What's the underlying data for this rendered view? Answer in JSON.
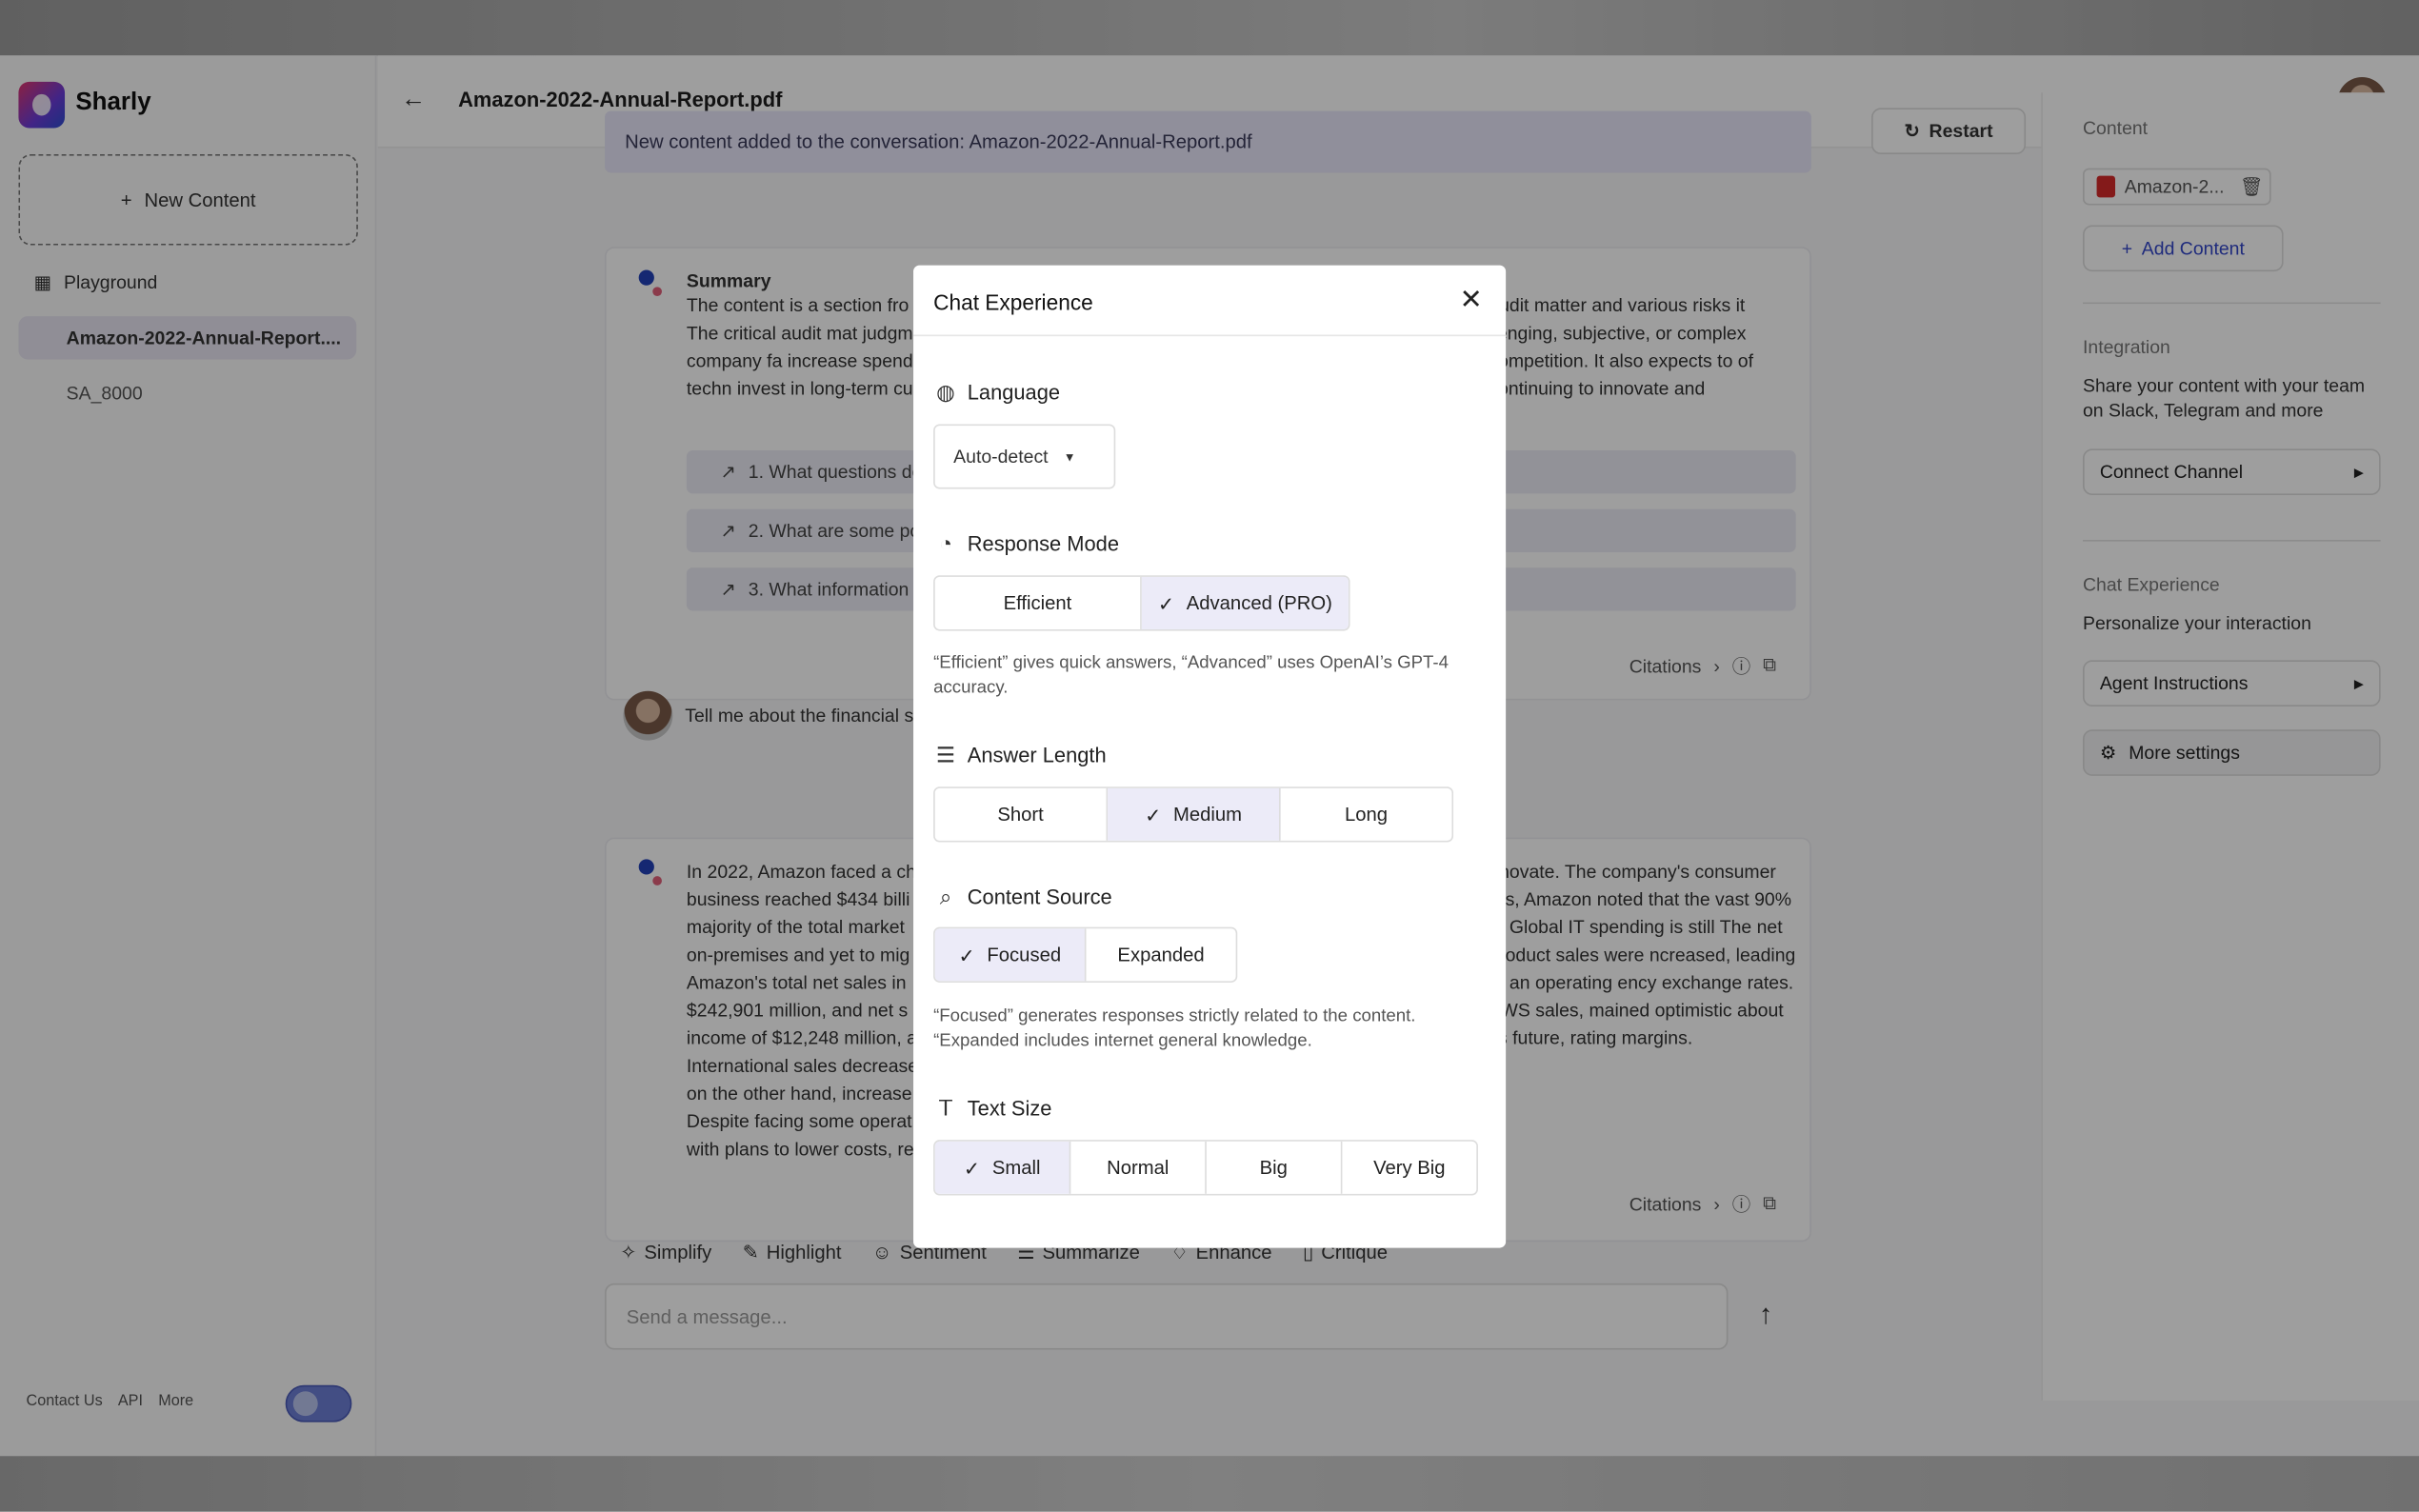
{
  "app": {
    "brand": "Sharly"
  },
  "sidebar": {
    "new_content": "New Content",
    "items": [
      {
        "label": "Playground"
      },
      {
        "label": "Amazon-2022-Annual-Report...."
      },
      {
        "label": "SA_8000"
      }
    ],
    "footer": [
      "Contact Us",
      "API",
      "More"
    ]
  },
  "header": {
    "title": "Amazon-2022-Annual-Report.pdf"
  },
  "chat": {
    "banner": "New content added to the conversation: Amazon-2022-Annual-Report.pdf",
    "restart": "Restart",
    "summary_title": "Summary",
    "summary_left": "The content is a section fro faces. The critical audit mat judgments. The company fa increase spending on techn invest in long-term custome",
    "summary_right": "audit matter and various risks it llenging, subjective, or complex competition. It also expects to of continuing to innovate and",
    "questions": [
      "1. What questions do",
      "2. What are some po",
      "3. What information"
    ],
    "citations": "Citations",
    "user_message": "Tell me about the financial s",
    "answer_left": "In 2022, Amazon faced a ch business reached $434 billi majority of the total market on-premises and yet to mig Amazon's total net sales in $242,901 million, and net s income of $12,248 million, a International sales decrease on the other hand, increase Despite facing some operat with plans to lower costs, re",
    "answer_right": "nnovate. The company's consumer res, Amazon noted that the vast 90% of Global IT spending is still The net product sales were ncreased, leading to an operating ency exchange rates. AWS sales, mained optimistic about its future, rating margins.",
    "tools": [
      "Simplify",
      "Highlight",
      "Sentiment",
      "Summarize",
      "Enhance",
      "Critique"
    ],
    "input_placeholder": "Send a message..."
  },
  "right_panel": {
    "content_label": "Content",
    "content_chip": "Amazon-2...",
    "add_content": "Add Content",
    "integration_label": "Integration",
    "integration_text": "Share your content with your team on Slack, Telegram and more",
    "connect_channel": "Connect Channel",
    "chat_experience_label": "Chat Experience",
    "chat_experience_text": "Personalize your interaction",
    "agent_instructions": "Agent Instructions",
    "more_settings": "More settings"
  },
  "modal": {
    "title": "Chat Experience",
    "language": {
      "label": "Language",
      "value": "Auto-detect"
    },
    "response_mode": {
      "label": "Response Mode",
      "options": [
        "Efficient",
        "Advanced (PRO)"
      ],
      "selected": "Advanced (PRO)",
      "hint": "“Efficient” gives quick answers, “Advanced” uses OpenAI’s GPT-4 accuracy."
    },
    "answer_length": {
      "label": "Answer Length",
      "options": [
        "Short",
        "Medium",
        "Long"
      ],
      "selected": "Medium"
    },
    "content_source": {
      "label": "Content Source",
      "options": [
        "Focused",
        "Expanded"
      ],
      "selected": "Focused",
      "hint1": "“Focused” generates responses strictly related to the content.",
      "hint2": "“Expanded includes internet general knowledge."
    },
    "text_size": {
      "label": "Text Size",
      "options": [
        "Small",
        "Normal",
        "Big",
        "Very Big"
      ],
      "selected": "Small"
    }
  }
}
